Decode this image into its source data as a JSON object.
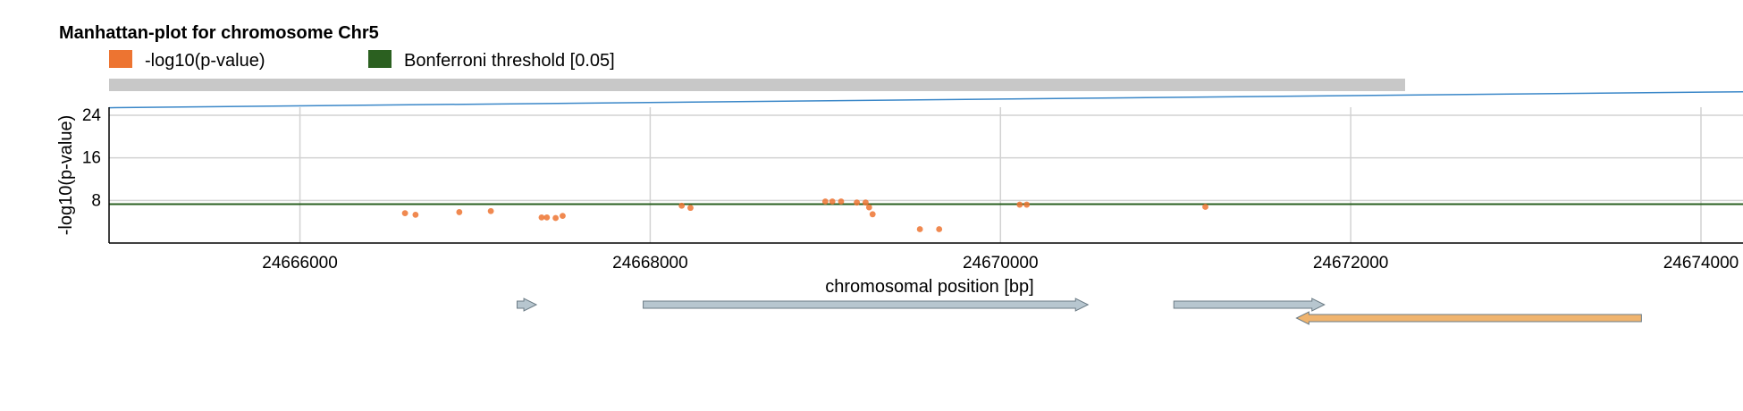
{
  "chart_data": {
    "type": "scatter",
    "title": "Manhattan-plot for chromosome Chr5",
    "xlabel": "chromosomal position [bp]",
    "ylabel": "-log10(p-value)",
    "xlim": [
      24664910,
      24674240
    ],
    "ylim": [
      0,
      25.5
    ],
    "x_ticks": [
      24666000,
      24668000,
      24670000,
      24672000,
      24674000
    ],
    "y_ticks": [
      8,
      16,
      24
    ],
    "grid": true,
    "legend": {
      "position": "top-left",
      "entries": [
        {
          "label": "-log10(p-value)",
          "color": "#ed7431"
        },
        {
          "label": "Bonferroni threshold [0.05]",
          "color": "#2b6020"
        }
      ]
    },
    "threshold": {
      "name": "Bonferroni threshold [0.05]",
      "value": 7.3,
      "color": "#2b6020"
    },
    "trend_line": {
      "color": "#3a87c8",
      "y_start": 25.4,
      "y_end": 28.4
    },
    "series": [
      {
        "name": "-log10(p-value)",
        "color": "#ed7431",
        "points": [
          {
            "x": 24666600,
            "y": 5.6
          },
          {
            "x": 24666660,
            "y": 5.3
          },
          {
            "x": 24666910,
            "y": 5.8
          },
          {
            "x": 24667090,
            "y": 6.0
          },
          {
            "x": 24667380,
            "y": 4.8
          },
          {
            "x": 24667410,
            "y": 4.8
          },
          {
            "x": 24667460,
            "y": 4.7
          },
          {
            "x": 24667500,
            "y": 5.1
          },
          {
            "x": 24668180,
            "y": 7.0
          },
          {
            "x": 24668230,
            "y": 6.6
          },
          {
            "x": 24669000,
            "y": 7.8
          },
          {
            "x": 24669040,
            "y": 7.8
          },
          {
            "x": 24669090,
            "y": 7.8
          },
          {
            "x": 24669180,
            "y": 7.6
          },
          {
            "x": 24669230,
            "y": 7.6
          },
          {
            "x": 24669250,
            "y": 6.7
          },
          {
            "x": 24669270,
            "y": 5.4
          },
          {
            "x": 24669540,
            "y": 2.6
          },
          {
            "x": 24669650,
            "y": 2.6
          },
          {
            "x": 24670110,
            "y": 7.2
          },
          {
            "x": 24670150,
            "y": 7.2
          },
          {
            "x": 24671170,
            "y": 6.8
          }
        ]
      }
    ],
    "gene_track": [
      {
        "start": 24667240,
        "end": 24667350,
        "strand": "+",
        "row": 0,
        "color": "#b7c6cf"
      },
      {
        "start": 24667960,
        "end": 24670500,
        "strand": "+",
        "row": 0,
        "color": "#b7c6cf"
      },
      {
        "start": 24670990,
        "end": 24671850,
        "strand": "+",
        "row": 0,
        "color": "#b7c6cf"
      },
      {
        "start": 24671690,
        "end": 24673660,
        "strand": "-",
        "row": 1,
        "color": "#f0b46e"
      }
    ]
  }
}
